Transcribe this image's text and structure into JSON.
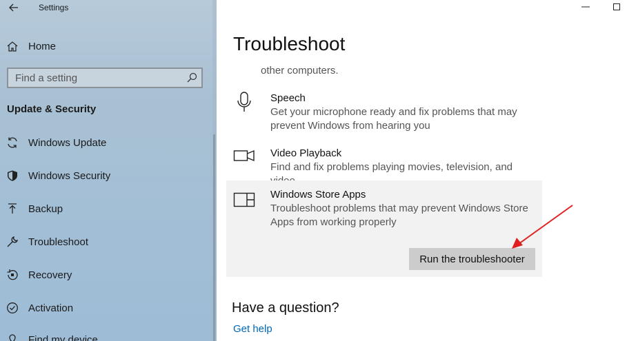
{
  "window": {
    "title": "Settings"
  },
  "sidebar": {
    "home_label": "Home",
    "search_placeholder": "Find a setting",
    "section_heading": "Update & Security",
    "items": [
      {
        "label": "Windows Update",
        "icon": "sync-icon"
      },
      {
        "label": "Windows Security",
        "icon": "shield-icon"
      },
      {
        "label": "Backup",
        "icon": "backup-arrow-icon"
      },
      {
        "label": "Troubleshoot",
        "icon": "wrench-icon"
      },
      {
        "label": "Recovery",
        "icon": "recovery-icon"
      },
      {
        "label": "Activation",
        "icon": "check-circle-icon"
      },
      {
        "label": "Find my device",
        "icon": "find-device-icon"
      }
    ]
  },
  "main": {
    "title": "Troubleshoot",
    "partial_text": "other computers.",
    "items": [
      {
        "name": "Speech",
        "description": "Get your microphone ready and fix problems that may prevent Windows from hearing you",
        "icon": "microphone-icon"
      },
      {
        "name": "Video Playback",
        "description": "Find and fix problems playing movies, television, and video",
        "icon": "video-camera-icon"
      },
      {
        "name": "Windows Store Apps",
        "description": "Troubleshoot problems that may prevent Windows Store Apps from working properly",
        "icon": "store-apps-icon"
      }
    ],
    "run_button_label": "Run the troubleshooter",
    "question_heading": "Have a question?",
    "help_link": "Get help"
  },
  "colors": {
    "accent": "#0067b8",
    "annotation_arrow": "#e02020",
    "selected_item_bg": "#f2f2f2"
  }
}
